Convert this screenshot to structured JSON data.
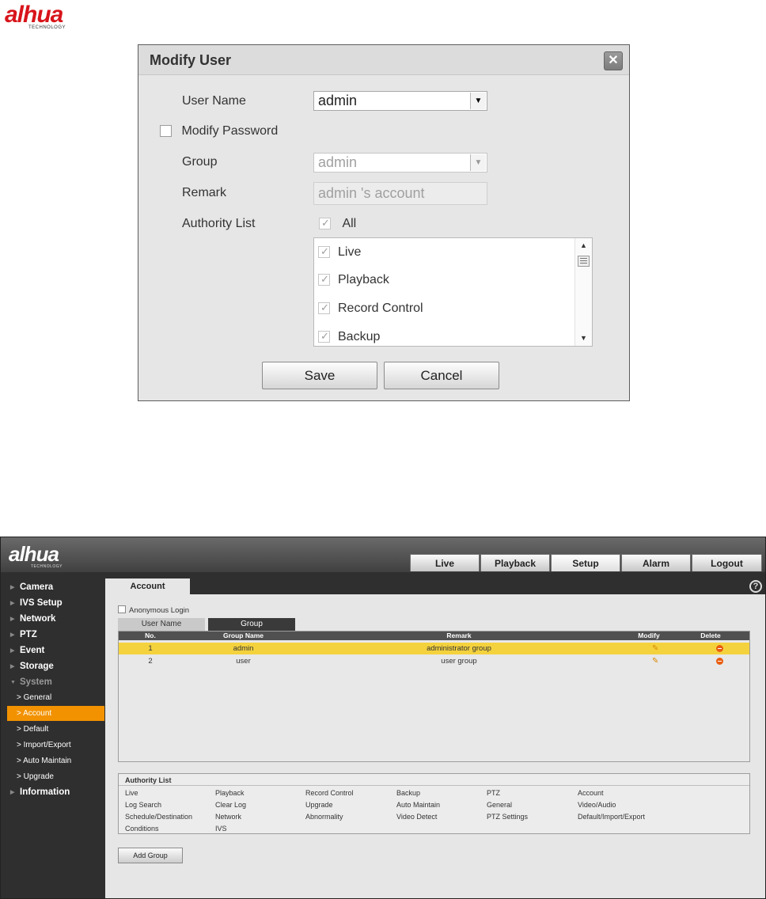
{
  "brand": {
    "logo_text": "alhua",
    "tagline": "TECHNOLOGY",
    "brand_color": "#d8141b"
  },
  "modal": {
    "title": "Modify User",
    "close_icon": "close-icon",
    "user_name_label": "User Name",
    "user_name_value": "admin",
    "modify_password_label": "Modify Password",
    "modify_password_checked": false,
    "group_label": "Group",
    "group_value": "admin",
    "remark_label": "Remark",
    "remark_value": "admin 's account",
    "authority_label": "Authority List",
    "all_label": "All",
    "authority_items": [
      "Live",
      "Playback",
      "Record Control",
      "Backup"
    ],
    "save_label": "Save",
    "cancel_label": "Cancel"
  },
  "app": {
    "logo_text": "alhua",
    "tagline": "TECHNOLOGY",
    "nav_tabs": [
      "Live",
      "Playback",
      "Setup",
      "Alarm",
      "Logout"
    ],
    "active_nav": "Setup",
    "sidebar": {
      "items": [
        "Camera",
        "IVS Setup",
        "Network",
        "PTZ",
        "Event",
        "Storage",
        "System"
      ],
      "system_subitems": [
        "General",
        "Account",
        "Default",
        "Import/Export",
        "Auto Maintain",
        "Upgrade"
      ],
      "active_subitem": "Account",
      "bottom_item": "Information",
      "accent_color": "#f29200"
    },
    "account_tab": "Account",
    "help_icon": "help-icon",
    "anonymous_login_label": "Anonymous Login",
    "sub_tabs": [
      "User Name",
      "Group"
    ],
    "active_sub_tab": "Group",
    "table": {
      "headers": [
        "No.",
        "Group Name",
        "Remark",
        "Modify",
        "Delete"
      ],
      "rows": [
        {
          "no": "1",
          "group_name": "admin",
          "remark": "administrator group"
        },
        {
          "no": "2",
          "group_name": "user",
          "remark": "user group"
        }
      ],
      "selected_row_color": "#f4d23e"
    },
    "authority_list": {
      "title": "Authority List",
      "rows": [
        [
          "Live",
          "Playback",
          "Record Control",
          "Backup",
          "PTZ",
          "Account"
        ],
        [
          "Log Search",
          "Clear Log",
          "Upgrade",
          "Auto Maintain",
          "General",
          "Video/Audio"
        ],
        [
          "Schedule/Destination",
          "Network",
          "Abnormality",
          "Video Detect",
          "PTZ Settings",
          "Default/Import/Export"
        ],
        [
          "Conditions",
          "IVS"
        ]
      ]
    },
    "add_group_label": "Add Group"
  }
}
